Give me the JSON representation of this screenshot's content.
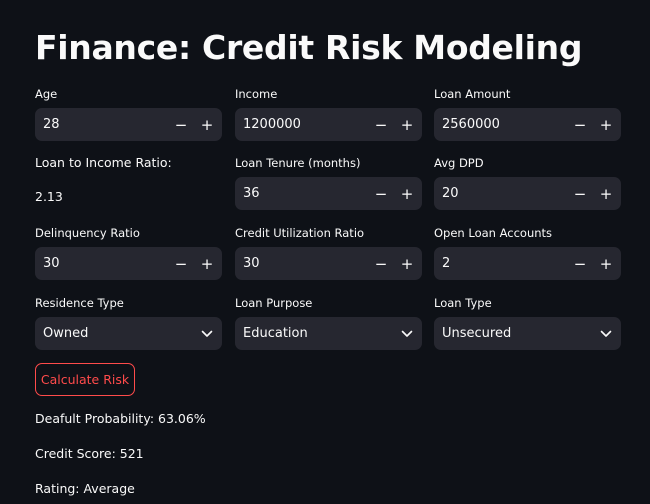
{
  "title": "Finance: Credit Risk Modeling",
  "fields": {
    "age": {
      "label": "Age",
      "value": "28"
    },
    "income": {
      "label": "Income",
      "value": "1200000"
    },
    "loan_amount": {
      "label": "Loan Amount",
      "value": "2560000"
    },
    "lti": {
      "label": "Loan to Income Ratio:",
      "value": "2.13"
    },
    "loan_tenure": {
      "label": "Loan Tenure (months)",
      "value": "36"
    },
    "avg_dpd": {
      "label": "Avg DPD",
      "value": "20"
    },
    "delinquency": {
      "label": "Delinquency Ratio",
      "value": "30"
    },
    "credit_util": {
      "label": "Credit Utilization Ratio",
      "value": "30"
    },
    "open_accounts": {
      "label": "Open Loan Accounts",
      "value": "2"
    },
    "residence_type": {
      "label": "Residence Type",
      "value": "Owned"
    },
    "loan_purpose": {
      "label": "Loan Purpose",
      "value": "Education"
    },
    "loan_type": {
      "label": "Loan Type",
      "value": "Unsecured"
    }
  },
  "stepper": {
    "minus": "−",
    "plus": "+"
  },
  "calculate_label": "Calculate Risk",
  "results": {
    "probability": "Deafult Probability: 63.06%",
    "credit_score": "Credit Score: 521",
    "rating": "Rating: Average"
  },
  "colors": {
    "background": "#0e1117",
    "input_bg": "#262730",
    "accent": "#ff4b4b"
  }
}
